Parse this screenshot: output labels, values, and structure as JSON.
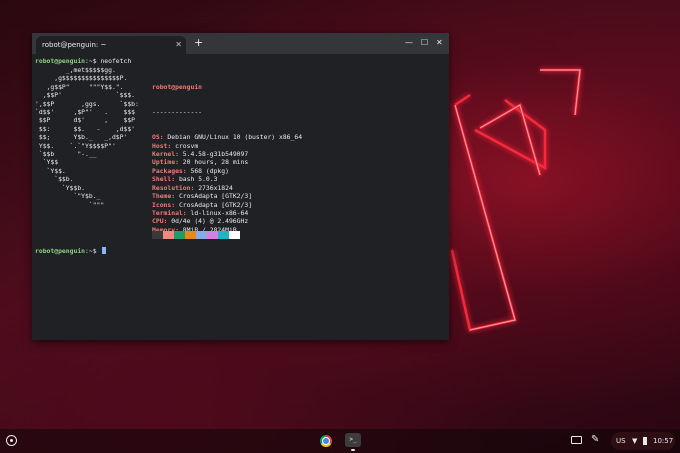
{
  "window": {
    "tab_title": "robot@penguin: ~",
    "close_glyph": "✕",
    "new_tab_glyph": "+",
    "minimize_glyph": "—",
    "maximize_glyph": "☐",
    "close_window_glyph": "✕"
  },
  "terminal": {
    "prompt": "robot@penguin",
    "first_command": ":~$ neofetch",
    "second_prompt_suffix": ":~$ ",
    "logo_lines": [
      "        _,met$$$$$gg.",
      "     ,g$$$$$$$$$$$$$$$P.",
      "   ,g$$P\"     \"\"\"Y$$.\".",
      "  ,$$P'              `$$$.",
      "',$$P       ,ggs.     `$$b:",
      "`d$$'     ,$P\"'   .    $$$",
      " $$P      d$'     ,    $$P",
      " $$:      $$.   -    ,d$$'",
      " $$;      Y$b._   _,d$P'",
      " Y$$.    `.`\"Y$$$$P\"'",
      " `$$b      \"-.__",
      "  `Y$$",
      "   `Y$$.",
      "     `$$b.",
      "       `Y$$b.",
      "          `\"Y$b._",
      "              `\"\"\""
    ],
    "user_host": "robot@penguin",
    "separator": "-------------",
    "info": [
      {
        "key": "OS",
        "value": "Debian GNU/Linux 10 (buster) x86_64"
      },
      {
        "key": "Host",
        "value": "crosvm"
      },
      {
        "key": "Kernel",
        "value": "5.4.58-g31b549097"
      },
      {
        "key": "Uptime",
        "value": "20 hours, 28 mins"
      },
      {
        "key": "Packages",
        "value": "568 (dpkg)"
      },
      {
        "key": "Shell",
        "value": "bash 5.0.3"
      },
      {
        "key": "Resolution",
        "value": "2736x1824"
      },
      {
        "key": "Theme",
        "value": "CrosAdapta [GTK2/3]"
      },
      {
        "key": "Icons",
        "value": "CrosAdapta [GTK2/3]"
      },
      {
        "key": "Terminal",
        "value": "ld-linux-x86-64"
      },
      {
        "key": "CPU",
        "value": "0d/4e (4) @ 2.496GHz"
      },
      {
        "key": "Memory",
        "value": "8MiB / 2824MiB"
      }
    ],
    "palette": [
      "#3a3a3a",
      "#ef8a80",
      "#1f9d6a",
      "#e8871e",
      "#8aa9e8",
      "#d97ee3",
      "#1bb7c9",
      "#ffffff"
    ]
  },
  "shelf": {
    "launcher_icon": "launcher-icon",
    "apps": [
      "chrome-icon",
      "terminal-icon"
    ],
    "terminal_glyph": ">_",
    "language": "US",
    "wifi_glyph": "▼",
    "clock": "10:57"
  },
  "colors": {
    "neon": "#ff2a3c",
    "prompt": "#8ed07f",
    "info_key": "#ef7b76"
  }
}
